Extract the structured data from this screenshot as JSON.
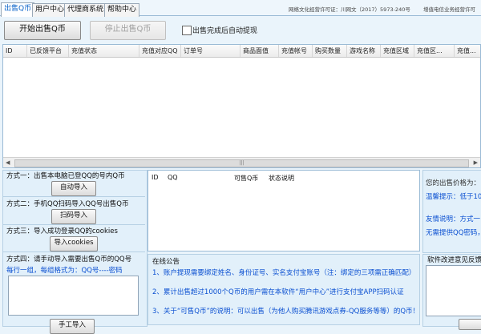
{
  "tabs": [
    {
      "label": "出售Q币",
      "active": true
    },
    {
      "label": "用户中心",
      "active": false
    },
    {
      "label": "代理商系统",
      "active": false
    },
    {
      "label": "帮助中心",
      "active": false
    }
  ],
  "license": {
    "icp": "网络文化经营许可证：川网文（2017）5973-240号",
    "telecom": "增值电信业务经营许可"
  },
  "toolbar": {
    "start_label": "开始出售Q币",
    "stop_label": "停止出售Q币",
    "auto_withdraw_label": "出售完成后自动提现",
    "auto_withdraw_checked": false
  },
  "main_table": {
    "columns": [
      "ID",
      "已反馈平台",
      "充值状态",
      "充值对应QQ",
      "订单号",
      "商品面值",
      "充值帐号",
      "购买数量",
      "游戏名称",
      "充值区域",
      "充值区...",
      "充值..."
    ],
    "rows": []
  },
  "methods": {
    "m1_label": "方式一：出售本电脑已登QQ的号内Q币",
    "m1_button": "自动导入",
    "m2_label": "方式二：手机QQ扫码导入QQ号出售Q币",
    "m2_button": "扫码导入",
    "m3_label": "方式三：导入成功登录QQ的cookies",
    "m3_button": "导入cookies",
    "m4_label": "方式四：请手动导入需要出售Q币的QQ号",
    "m4_hint": "每行一组，每组格式为：QQ号----密码",
    "m4_value": "",
    "m4_button": "手工导入"
  },
  "qq_table": {
    "columns": [
      "ID",
      "QQ",
      "可售Q币",
      "状态说明"
    ],
    "rows": []
  },
  "notice": {
    "title": "在线公告",
    "items": [
      "1、账户提现需要绑定姓名、身份证号、实名支付宝账号（注：绑定的三项需正确匹配）",
      "2、累计出售超过1000个Q币的用户需在本软件“用户中心”进行支付宝APP扫码认证",
      "3、关于“可售Q币”的说明：可以出售（为他人购买腾讯游戏点券-QQ服务等等）的Q币！"
    ]
  },
  "right_panel": {
    "price_label": "您的出售价格为：",
    "tip_label": "温馨提示：低于10",
    "friendly_label": "友情说明：方式一",
    "no_qq_pwd": "无需提供QQ密码，",
    "feedback_title": "软件改进意见反馈"
  }
}
